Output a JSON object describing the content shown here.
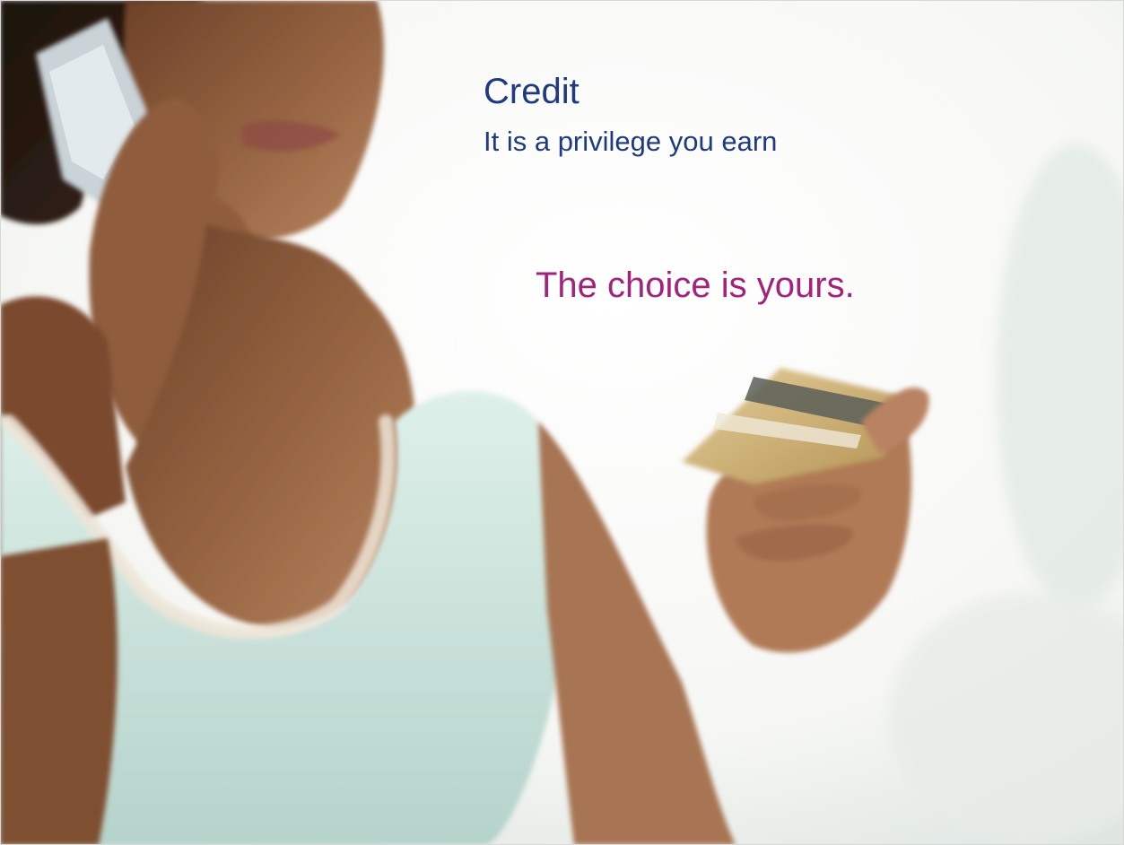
{
  "slide": {
    "title": "Credit",
    "subtitle": "It is a privilege you earn",
    "tagline": "The choice is yours."
  },
  "colors": {
    "title": "#1f3a80",
    "subtitle": "#1f3a80",
    "tagline": "#a3237c",
    "background": "#fdfdfc",
    "skin": "#8a5a3c",
    "shirt": "#cfe6df",
    "card_gold": "#c8aa6e",
    "card_stripe": "#5a5e58"
  },
  "photo": {
    "subject": "woman-on-phone-holding-credit-card",
    "icons": [
      "phone-icon",
      "credit-card-icon"
    ]
  }
}
